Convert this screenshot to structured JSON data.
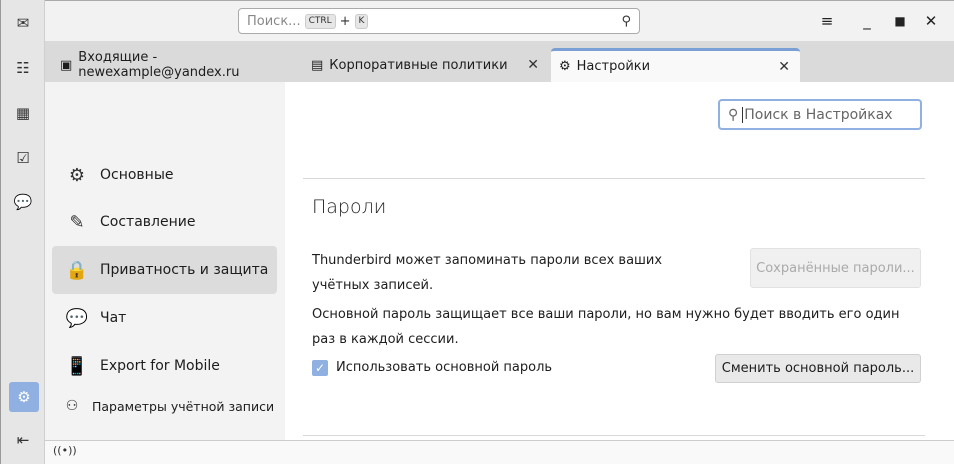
{
  "search": {
    "placeholder": "Поиск...",
    "kbd1": "CTRL",
    "plus": "+",
    "kbd2": "K"
  },
  "tabs": [
    {
      "label": "Входящие - newexample@yandex.ru"
    },
    {
      "label": "Корпоративные политики"
    },
    {
      "label": "Настройки"
    }
  ],
  "nav": {
    "items": [
      {
        "label": "Основные"
      },
      {
        "label": "Составление"
      },
      {
        "label": "Приватность и защита"
      },
      {
        "label": "Чат"
      },
      {
        "label": "Export for Mobile"
      },
      {
        "label": "Параметры учётной записи"
      }
    ]
  },
  "settings_search": {
    "placeholder": "Поиск в Настройках"
  },
  "passwords": {
    "title": "Пароли",
    "desc1": "Thunderbird может запоминать пароли всех ваших учётных записей.",
    "saved_button": "Сохранённые пароли...",
    "desc2": "Основной пароль защищает все ваши пароли, но вам нужно будет вводить его один раз в каждой сессии.",
    "use_primary_label": "Использовать основной пароль",
    "use_primary_checked": true,
    "change_button": "Сменить основной пароль..."
  },
  "colors": {
    "accent": "#7a9fd4"
  }
}
